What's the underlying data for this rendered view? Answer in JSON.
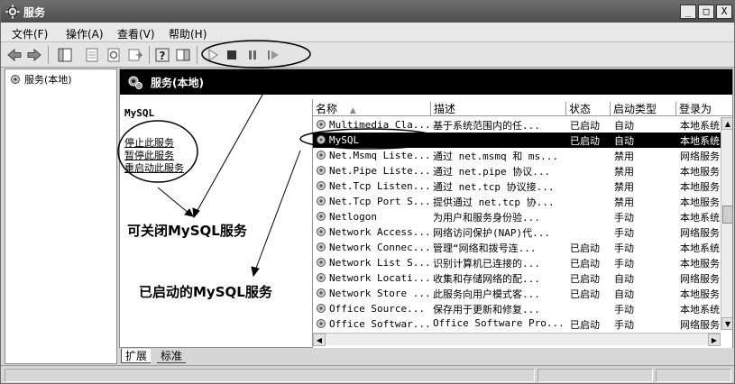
{
  "window": {
    "title": "服务"
  },
  "window_buttons": [
    "_",
    "□",
    "X"
  ],
  "menu": [
    "文件(F)",
    "操作(A)",
    "查看(V)",
    "帮助(H)"
  ],
  "tree": {
    "root": "服务(本地)"
  },
  "pane": {
    "header": "服务(本地)",
    "selected_service": "MySQL",
    "actions": [
      "停止此服务",
      "暂停此服务",
      "重启动此服务"
    ]
  },
  "annotations": {
    "close_note": "可关闭MySQL服务",
    "started_note": "已启动的MySQL服务"
  },
  "columns": [
    "名称",
    "描述",
    "状态",
    "启动类型",
    "登录为"
  ],
  "services": [
    {
      "name": "Multimedia Cla...",
      "desc": "基于系统范围内的任...",
      "status": "已启动",
      "start": "自动",
      "logon": "本地系统"
    },
    {
      "name": "MySQL",
      "desc": "",
      "status": "已启动",
      "start": "自动",
      "logon": "本地系统",
      "selected": true
    },
    {
      "name": "Net.Msmq Liste...",
      "desc": "通过 net.msmq 和 ms...",
      "status": "",
      "start": "禁用",
      "logon": "网络服务"
    },
    {
      "name": "Net.Pipe Liste...",
      "desc": "通过 net.pipe 协议...",
      "status": "",
      "start": "禁用",
      "logon": "本地服务"
    },
    {
      "name": "Net.Tcp Listen...",
      "desc": "通过 net.tcp 协议接...",
      "status": "",
      "start": "禁用",
      "logon": "本地服务"
    },
    {
      "name": "Net.Tcp Port S...",
      "desc": "提供通过 net.tcp 协...",
      "status": "",
      "start": "禁用",
      "logon": "本地服务"
    },
    {
      "name": "Netlogon",
      "desc": "为用户和服务身份验...",
      "status": "",
      "start": "手动",
      "logon": "本地系统"
    },
    {
      "name": "Network Access...",
      "desc": "网络访问保护(NAP)代...",
      "status": "",
      "start": "手动",
      "logon": "网络服务"
    },
    {
      "name": "Network Connec...",
      "desc": "管理“网络和拨号连...",
      "status": "已启动",
      "start": "手动",
      "logon": "本地系统"
    },
    {
      "name": "Network List S...",
      "desc": "识别计算机已连接的...",
      "status": "已启动",
      "start": "手动",
      "logon": "本地服务"
    },
    {
      "name": "Network Locati...",
      "desc": "收集和存储网络的配...",
      "status": "已启动",
      "start": "自动",
      "logon": "网络服务"
    },
    {
      "name": "Network Store ...",
      "desc": "此服务向用户模式客...",
      "status": "已启动",
      "start": "自动",
      "logon": "本地服务"
    },
    {
      "name": "Office  Source...",
      "desc": "保存用于更新和修复...",
      "status": "",
      "start": "手动",
      "logon": "本地系统"
    },
    {
      "name": "Office Softwar...",
      "desc": "Office Software Pro...",
      "status": "已启动",
      "start": "手动",
      "logon": "网络服务"
    }
  ],
  "tabs": [
    "扩展",
    "标准"
  ],
  "icons": {
    "app": "gear-icon",
    "back": "back-arrow-icon",
    "forward": "forward-arrow-icon",
    "play": "play-icon",
    "stop": "stop-icon",
    "pause": "pause-icon",
    "restart": "restart-icon"
  }
}
